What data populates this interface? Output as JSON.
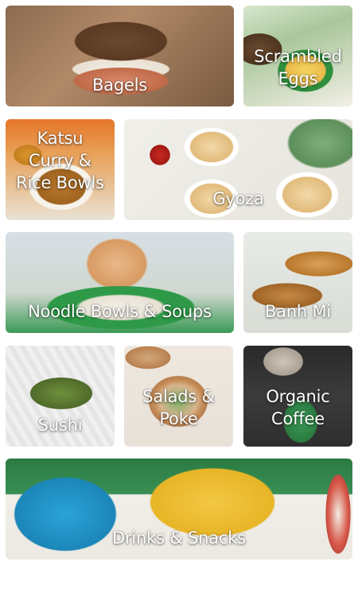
{
  "tiles": [
    {
      "key": "bagels",
      "label": "Bagels"
    },
    {
      "key": "scrambled-eggs",
      "label": "Scrambled\nEggs"
    },
    {
      "key": "katsu-curry-rice-bowls",
      "label": "Katsu\nCurry &\nRice Bowls"
    },
    {
      "key": "gyoza",
      "label": "Gyoza"
    },
    {
      "key": "noodle-bowls-soups",
      "label": "Noodle Bowls & Soups"
    },
    {
      "key": "banh-mi",
      "label": "Banh Mi"
    },
    {
      "key": "sushi",
      "label": "Sushi"
    },
    {
      "key": "salads-poke",
      "label": "Salads &\nPoke"
    },
    {
      "key": "organic-coffee",
      "label": "Organic\nCoffee"
    },
    {
      "key": "drinks-snacks",
      "label": "Drinks & Snacks"
    }
  ],
  "colors": {
    "label_text": "#ffffff",
    "page_background": "#ffffff",
    "brand_green": "#2e9a48"
  }
}
